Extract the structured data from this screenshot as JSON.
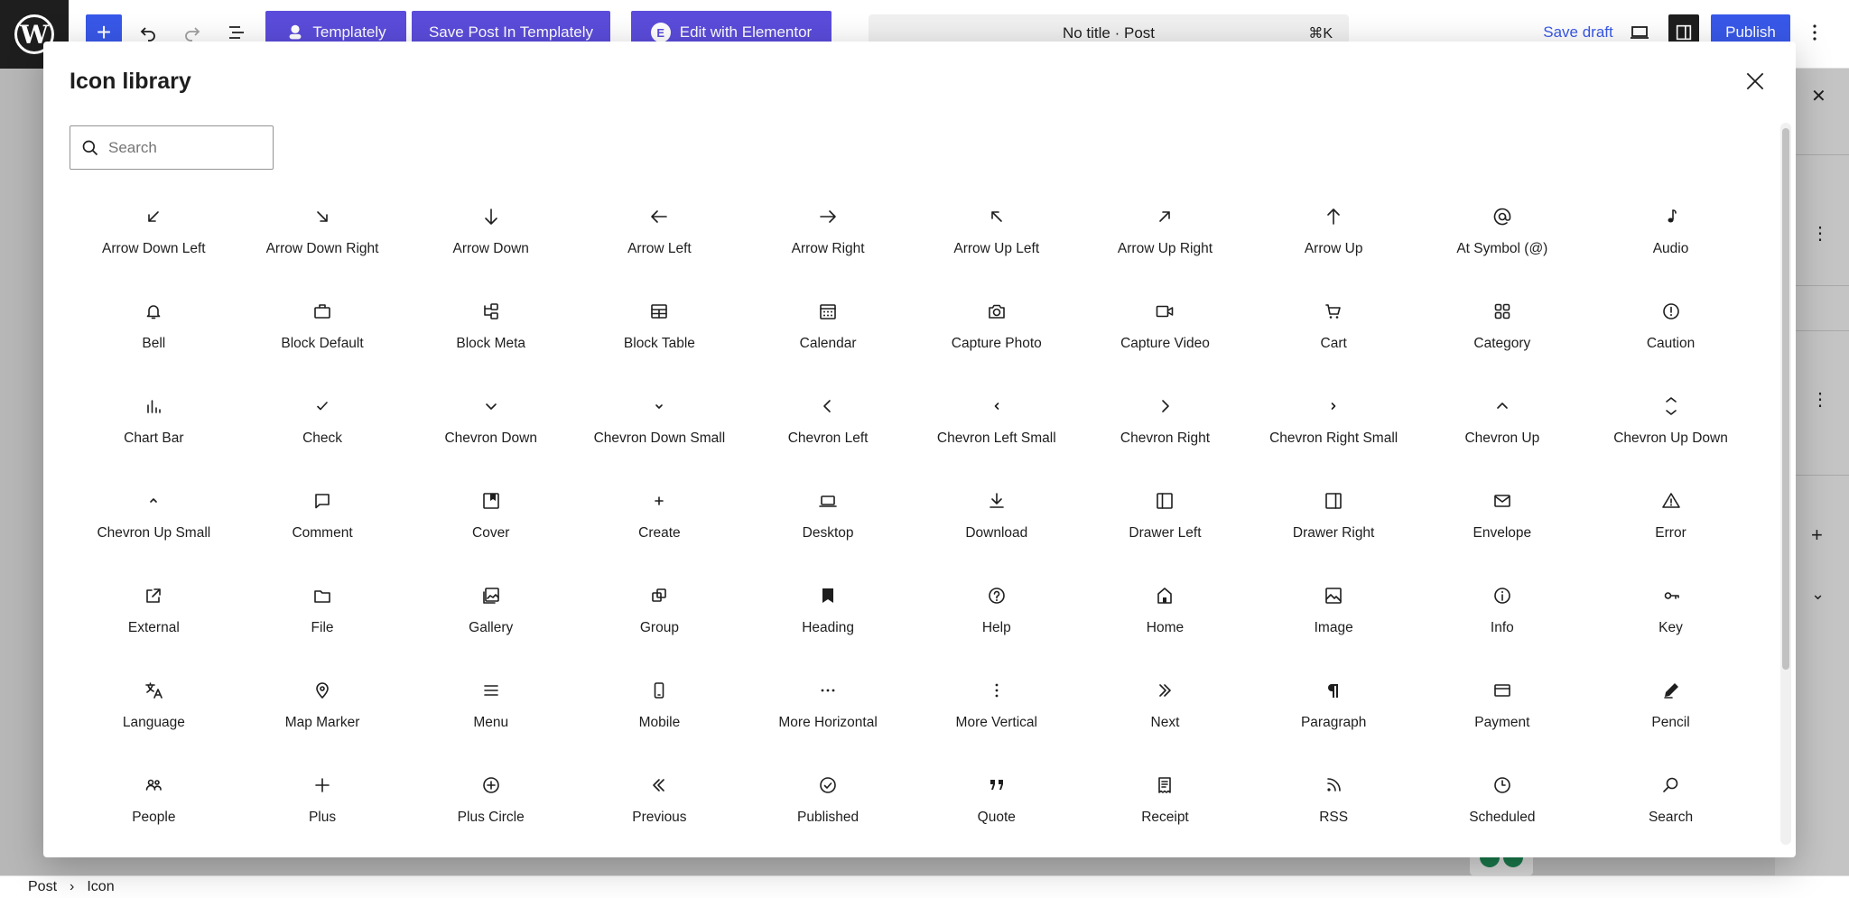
{
  "toolbar": {
    "logo": "W",
    "add_label": "+",
    "templately_label": "Templately",
    "save_templately_label": "Save Post In Templately",
    "elementor_label": "Edit with Elementor",
    "elementor_badge": "E",
    "document_title": "No title · Post",
    "shortcut": "⌘K",
    "save_draft_label": "Save draft",
    "publish_label": "Publish"
  },
  "modal": {
    "title": "Icon library",
    "search_placeholder": "Search",
    "icons": [
      {
        "label": "Arrow Down Left",
        "icon": "arrow-down-left"
      },
      {
        "label": "Arrow Down Right",
        "icon": "arrow-down-right"
      },
      {
        "label": "Arrow Down",
        "icon": "arrow-down"
      },
      {
        "label": "Arrow Left",
        "icon": "arrow-left"
      },
      {
        "label": "Arrow Right",
        "icon": "arrow-right"
      },
      {
        "label": "Arrow Up Left",
        "icon": "arrow-up-left"
      },
      {
        "label": "Arrow Up Right",
        "icon": "arrow-up-right"
      },
      {
        "label": "Arrow Up",
        "icon": "arrow-up"
      },
      {
        "label": "At Symbol (@)",
        "icon": "at-symbol"
      },
      {
        "label": "Audio",
        "icon": "audio"
      },
      {
        "label": "Bell",
        "icon": "bell"
      },
      {
        "label": "Block Default",
        "icon": "block-default"
      },
      {
        "label": "Block Meta",
        "icon": "block-meta"
      },
      {
        "label": "Block Table",
        "icon": "block-table"
      },
      {
        "label": "Calendar",
        "icon": "calendar"
      },
      {
        "label": "Capture Photo",
        "icon": "capture-photo"
      },
      {
        "label": "Capture Video",
        "icon": "capture-video"
      },
      {
        "label": "Cart",
        "icon": "cart"
      },
      {
        "label": "Category",
        "icon": "category"
      },
      {
        "label": "Caution",
        "icon": "caution"
      },
      {
        "label": "Chart Bar",
        "icon": "chart-bar"
      },
      {
        "label": "Check",
        "icon": "check"
      },
      {
        "label": "Chevron Down",
        "icon": "chevron-down"
      },
      {
        "label": "Chevron Down Small",
        "icon": "chevron-down-small"
      },
      {
        "label": "Chevron Left",
        "icon": "chevron-left"
      },
      {
        "label": "Chevron Left Small",
        "icon": "chevron-left-small"
      },
      {
        "label": "Chevron Right",
        "icon": "chevron-right"
      },
      {
        "label": "Chevron Right Small",
        "icon": "chevron-right-small"
      },
      {
        "label": "Chevron Up",
        "icon": "chevron-up"
      },
      {
        "label": "Chevron Up Down",
        "icon": "chevron-up-down"
      },
      {
        "label": "Chevron Up Small",
        "icon": "chevron-up-small"
      },
      {
        "label": "Comment",
        "icon": "comment"
      },
      {
        "label": "Cover",
        "icon": "cover"
      },
      {
        "label": "Create",
        "icon": "create"
      },
      {
        "label": "Desktop",
        "icon": "desktop"
      },
      {
        "label": "Download",
        "icon": "download"
      },
      {
        "label": "Drawer Left",
        "icon": "drawer-left"
      },
      {
        "label": "Drawer Right",
        "icon": "drawer-right"
      },
      {
        "label": "Envelope",
        "icon": "envelope"
      },
      {
        "label": "Error",
        "icon": "error"
      },
      {
        "label": "External",
        "icon": "external"
      },
      {
        "label": "File",
        "icon": "file"
      },
      {
        "label": "Gallery",
        "icon": "gallery"
      },
      {
        "label": "Group",
        "icon": "group"
      },
      {
        "label": "Heading",
        "icon": "heading"
      },
      {
        "label": "Help",
        "icon": "help"
      },
      {
        "label": "Home",
        "icon": "home"
      },
      {
        "label": "Image",
        "icon": "image"
      },
      {
        "label": "Info",
        "icon": "info"
      },
      {
        "label": "Key",
        "icon": "key"
      },
      {
        "label": "Language",
        "icon": "language"
      },
      {
        "label": "Map Marker",
        "icon": "map-marker"
      },
      {
        "label": "Menu",
        "icon": "menu"
      },
      {
        "label": "Mobile",
        "icon": "mobile"
      },
      {
        "label": "More Horizontal",
        "icon": "more-horizontal"
      },
      {
        "label": "More Vertical",
        "icon": "more-vertical"
      },
      {
        "label": "Next",
        "icon": "next"
      },
      {
        "label": "Paragraph",
        "icon": "paragraph"
      },
      {
        "label": "Payment",
        "icon": "payment"
      },
      {
        "label": "Pencil",
        "icon": "pencil"
      },
      {
        "label": "People",
        "icon": "people"
      },
      {
        "label": "Plus",
        "icon": "plus"
      },
      {
        "label": "Plus Circle",
        "icon": "plus-circle"
      },
      {
        "label": "Previous",
        "icon": "previous"
      },
      {
        "label": "Published",
        "icon": "published"
      },
      {
        "label": "Quote",
        "icon": "quote"
      },
      {
        "label": "Receipt",
        "icon": "receipt"
      },
      {
        "label": "RSS",
        "icon": "rss"
      },
      {
        "label": "Scheduled",
        "icon": "scheduled"
      },
      {
        "label": "Search",
        "icon": "search"
      }
    ]
  },
  "breadcrumb": {
    "root": "Post",
    "separator": "›",
    "current": "Icon"
  },
  "colors": {
    "accent": "#3858e9",
    "templately": "#5b4cdb",
    "text": "#1e1e1e"
  }
}
